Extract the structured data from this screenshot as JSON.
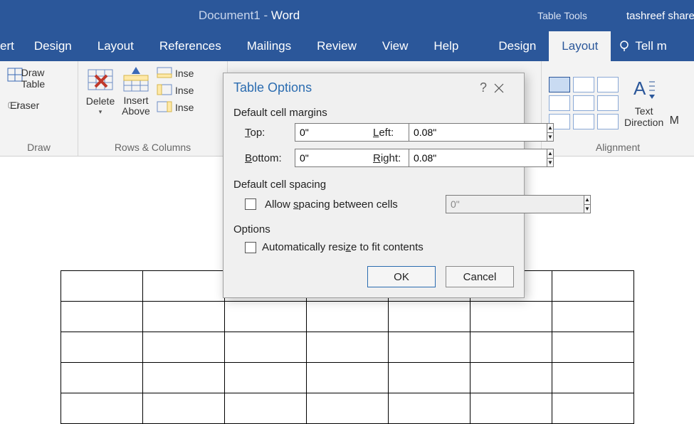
{
  "titlebar": {
    "doc": "Document1",
    "sep": "  -  ",
    "app": "Word",
    "table_tools": "Table Tools",
    "user": "tashreef sharee"
  },
  "tabs": {
    "insert_partial": "ert",
    "design": "Design",
    "layout": "Layout",
    "references": "References",
    "mailings": "Mailings",
    "review": "Review",
    "view": "View",
    "help": "Help",
    "tt_design": "Design",
    "tt_layout": "Layout",
    "tellme": "Tell m"
  },
  "ribbon": {
    "draw": {
      "draw_table": "Draw Table",
      "eraser": "Eraser",
      "group": "Draw"
    },
    "rows_cols": {
      "delete": "Delete",
      "insert_above": "Insert Above",
      "inse1": "Inse",
      "inse2": "Inse",
      "inse3": "Inse",
      "group": "Rows & Columns"
    },
    "alignment": {
      "text_direction": "Text Direction",
      "m_partial": "M",
      "group": "Alignment"
    }
  },
  "dialog": {
    "title": "Table Options",
    "section_margins": "Default cell margins",
    "labels": {
      "top": "Top:",
      "bottom": "Bottom:",
      "left": "Left:",
      "right": "Right:"
    },
    "values": {
      "top": "0\"",
      "bottom": "0\"",
      "left": "0.08\"",
      "right": "0.08\""
    },
    "section_spacing": "Default cell spacing",
    "allow_spacing": "Allow spacing between cells",
    "spacing_value": "0\"",
    "section_options": "Options",
    "auto_resize": "Automatically resize to fit contents",
    "ok": "OK",
    "cancel": "Cancel"
  },
  "doc_table": {
    "rows": 5,
    "cols": 7
  }
}
